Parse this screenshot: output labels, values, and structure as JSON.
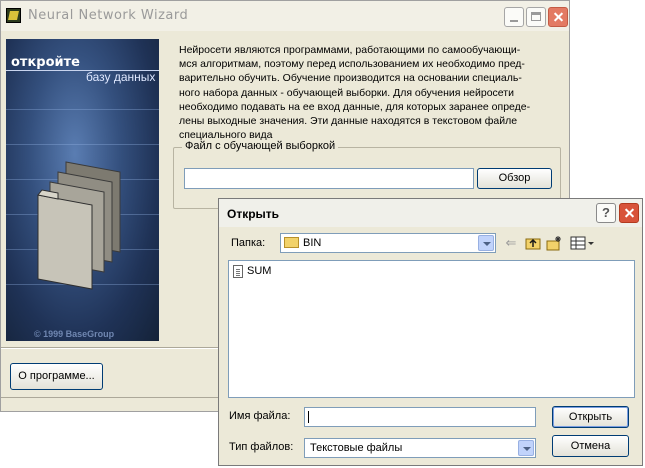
{
  "wizard": {
    "title": "Neural Network Wizard",
    "banner": {
      "title": "откройте",
      "subtitle": "базу данных",
      "copyright": "© 1999 BaseGroup"
    },
    "description_lines": [
      "Нейросети являются программами, работающими по самообучающи-",
      "мся алгоритмам, поэтому перед использованием их необходимо пред-",
      "варительно обучить. Обучение производится на основании  специаль-",
      "ного набора данных - обучающей  выборки.  Для  обучения  нейросети",
      "необходимо подавать на ее вход данные, для которых заранее опреде-",
      "лены выходные значения. Эти данные находятся в  текстовом  файле",
      "специального вида"
    ],
    "file_group_label": "Файл с обучающей выборкой",
    "file_path": "",
    "browse_label": "Обзор",
    "about_label": "О программе..."
  },
  "open_dialog": {
    "title": "Открыть",
    "help_label": "?",
    "look_in_label": "Папка:",
    "look_in_value": "BIN",
    "toolbar_icons": [
      "back-icon",
      "up-folder-icon",
      "new-folder-icon",
      "view-menu-icon"
    ],
    "files": [
      {
        "name": "SUM",
        "icon": "text-file-icon"
      }
    ],
    "file_name_label": "Имя файла:",
    "file_name_value": "",
    "file_type_label": "Тип файлов:",
    "file_type_value": "Текстовые файлы",
    "open_label": "Открыть",
    "cancel_label": "Отмена"
  }
}
